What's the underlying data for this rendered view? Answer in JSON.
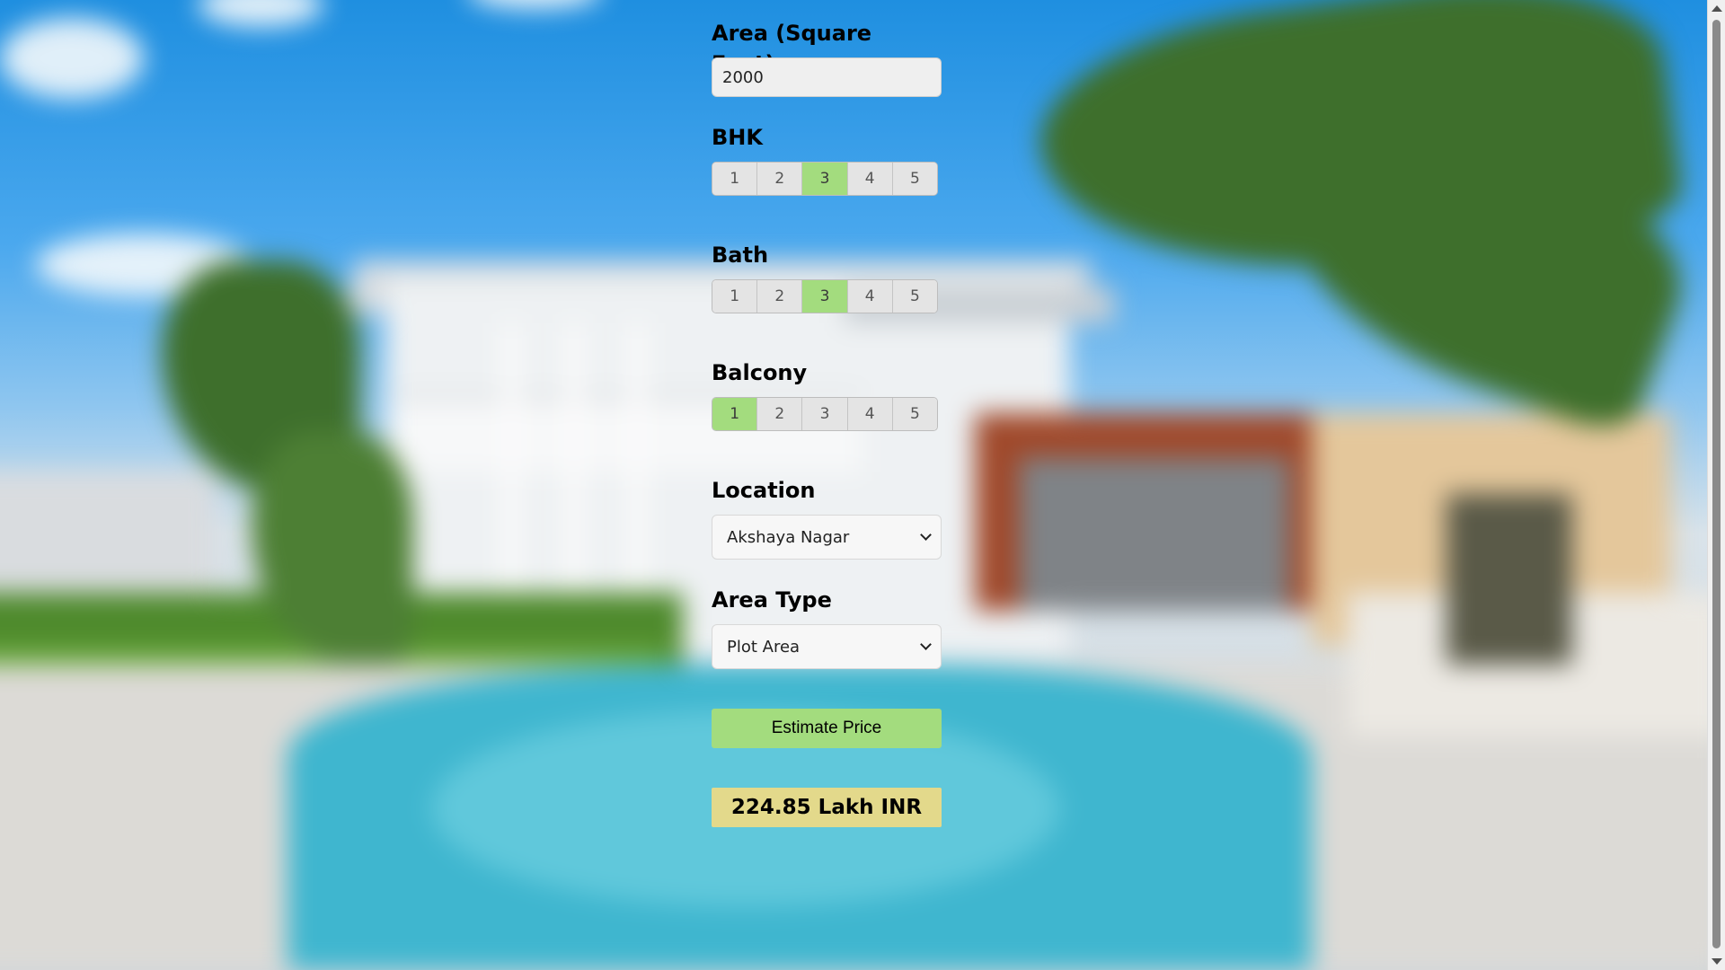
{
  "form": {
    "area": {
      "label": "Area (Square Feet)",
      "value": "2000"
    },
    "bhk": {
      "label": "BHK",
      "options": [
        "1",
        "2",
        "3",
        "4",
        "5"
      ],
      "selected": "3"
    },
    "bath": {
      "label": "Bath",
      "options": [
        "1",
        "2",
        "3",
        "4",
        "5"
      ],
      "selected": "3"
    },
    "balcony": {
      "label": "Balcony",
      "options": [
        "1",
        "2",
        "3",
        "4",
        "5"
      ],
      "selected": "1"
    },
    "location": {
      "label": "Location",
      "selected": "Akshaya Nagar"
    },
    "area_type": {
      "label": "Area Type",
      "selected": "Plot Area"
    },
    "estimate_button": "Estimate Price",
    "result": "224.85 Lakh INR"
  },
  "colors": {
    "selected_option": "#a3dc7e",
    "estimate_button": "#a3dc7e",
    "result_background": "#e3d98b"
  },
  "icons": {
    "dropdown": "chevron-down-icon",
    "scroll_up": "scroll-up-arrow-icon",
    "scroll_down": "scroll-down-arrow-icon"
  }
}
